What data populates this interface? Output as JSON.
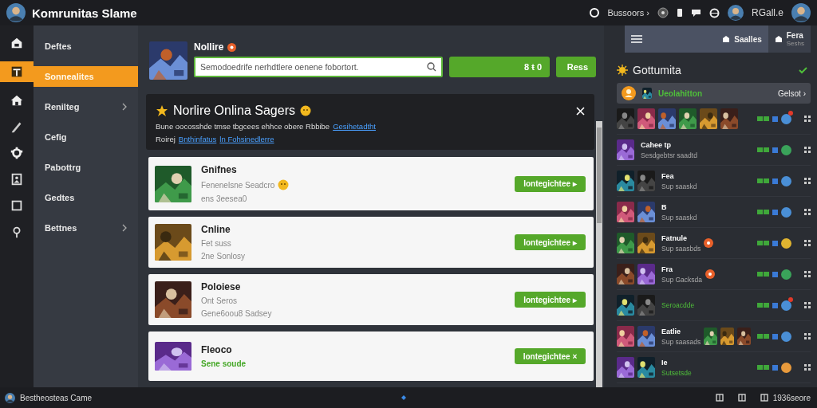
{
  "topbar": {
    "title": "Komrunitas Slame",
    "account_link": "Bussoors ›",
    "user_name": "RGall.e"
  },
  "rail": [
    {
      "selected": false
    },
    {
      "selected": true
    },
    {
      "selected": false
    },
    {
      "selected": false
    },
    {
      "selected": false
    },
    {
      "selected": false
    },
    {
      "selected": false
    },
    {
      "selected": false
    }
  ],
  "nav": {
    "items": [
      {
        "label": "Deftes",
        "selected": false,
        "expandable": false
      },
      {
        "label": "Sonnealites",
        "selected": true,
        "expandable": false
      },
      {
        "label": "Renilteg",
        "selected": false,
        "expandable": true
      },
      {
        "label": "Cefig",
        "selected": false,
        "expandable": false
      },
      {
        "label": "Pabottrg",
        "selected": false,
        "expandable": false
      },
      {
        "label": "Gedtes",
        "selected": false,
        "expandable": false
      },
      {
        "label": "Bettnes",
        "selected": false,
        "expandable": true
      }
    ]
  },
  "profile": {
    "name": "Nollire",
    "search": {
      "placeholder": "Semodoedrife nerhdtlere oenene fobortort."
    },
    "action_button": "8 ŧ 0",
    "secondary_button": "Ress"
  },
  "notice": {
    "title": "Norlire Onlina Sagers",
    "text": "Bune oocosshde tmse tbgcees ehhce obere Rbbibe",
    "link": "Gesihetadtht",
    "second_line": "Roirej",
    "links": [
      "Bnthinfatus",
      "ln Fohsinedlerre"
    ]
  },
  "cards": [
    {
      "title": "Gnifnes",
      "lines": [
        {
          "text": "Fenenelsne Seadcro",
          "kind": "muted",
          "emoji": true
        },
        {
          "text": "ens 3eesea0",
          "kind": "muted",
          "emoji": false
        }
      ],
      "button": "Iontegichtee",
      "button_mark": "▸"
    },
    {
      "title": "Cnline",
      "lines": [
        {
          "text": "Fet suss",
          "kind": "muted",
          "emoji": false
        },
        {
          "text": "2ne Sonlosy",
          "kind": "muted",
          "emoji": false
        }
      ],
      "button": "Iontegichtee",
      "button_mark": "▸"
    },
    {
      "title": "Poloiese",
      "lines": [
        {
          "text": "Ont Seros",
          "kind": "muted",
          "emoji": false
        },
        {
          "text": "Gene6oou8 Sadsey",
          "kind": "muted",
          "emoji": false
        }
      ],
      "button": "Iontegichtee",
      "button_mark": "▸"
    },
    {
      "title": "Fleoco",
      "lines": [
        {
          "text": "Sene soude",
          "kind": "highlight",
          "emoji": false
        }
      ],
      "button": "Iontegichtee",
      "button_mark": "×"
    }
  ],
  "friends": {
    "tabs": [
      {
        "label": "Saalles",
        "selected": true
      },
      {
        "label": "Fera",
        "sub": "Seshs",
        "selected": false
      }
    ],
    "title": "Gottumita",
    "search": {
      "name": "Ueolahitton",
      "action": "Gelsot ›"
    },
    "rows": [
      {
        "color": "#4a8fd6",
        "notification": true,
        "flagged": false
      },
      {
        "name": "Cahee tp",
        "status": {
          "text": "Sesdgebtsr saadtd",
          "kind": "muted"
        },
        "color": "#3aa35a",
        "notification": false,
        "flagged": false
      },
      {
        "name": "Fea",
        "status": {
          "text": "Sup saaskd",
          "kind": "muted"
        },
        "color": "#4a8fd6",
        "notification": false,
        "flagged": false
      },
      {
        "name": "B",
        "status": {
          "text": "Sup saaskd",
          "kind": "muted"
        },
        "color": "#4a8fd6",
        "notification": false,
        "flagged": false
      },
      {
        "name": "Fatnule",
        "status": {
          "text": "Sup saasbds",
          "kind": "muted"
        },
        "color": "#e0b430",
        "notification": false,
        "flagged": true
      },
      {
        "name": "Fra",
        "status": {
          "text": "Sup Gacksda",
          "kind": "muted"
        },
        "color": "#3aa35a",
        "notification": false,
        "flagged": true
      },
      {
        "status": {
          "text": "Seroacdde",
          "kind": "highlight"
        },
        "color": "#4a8fd6",
        "notification": true,
        "flagged": false
      },
      {
        "name": "Eatlie",
        "status": {
          "text": "Sup saasads",
          "kind": "muted"
        },
        "color": "#4a8fd6",
        "notification": false,
        "flagged": false
      },
      {
        "name": "Ie",
        "status": {
          "text": "Sutsetsde",
          "kind": "highlight"
        },
        "color": "#e89a3c",
        "notification": false,
        "flagged": false
      }
    ]
  },
  "status_bar": {
    "title": "Bestheosteas Came",
    "count": "1936seore"
  }
}
